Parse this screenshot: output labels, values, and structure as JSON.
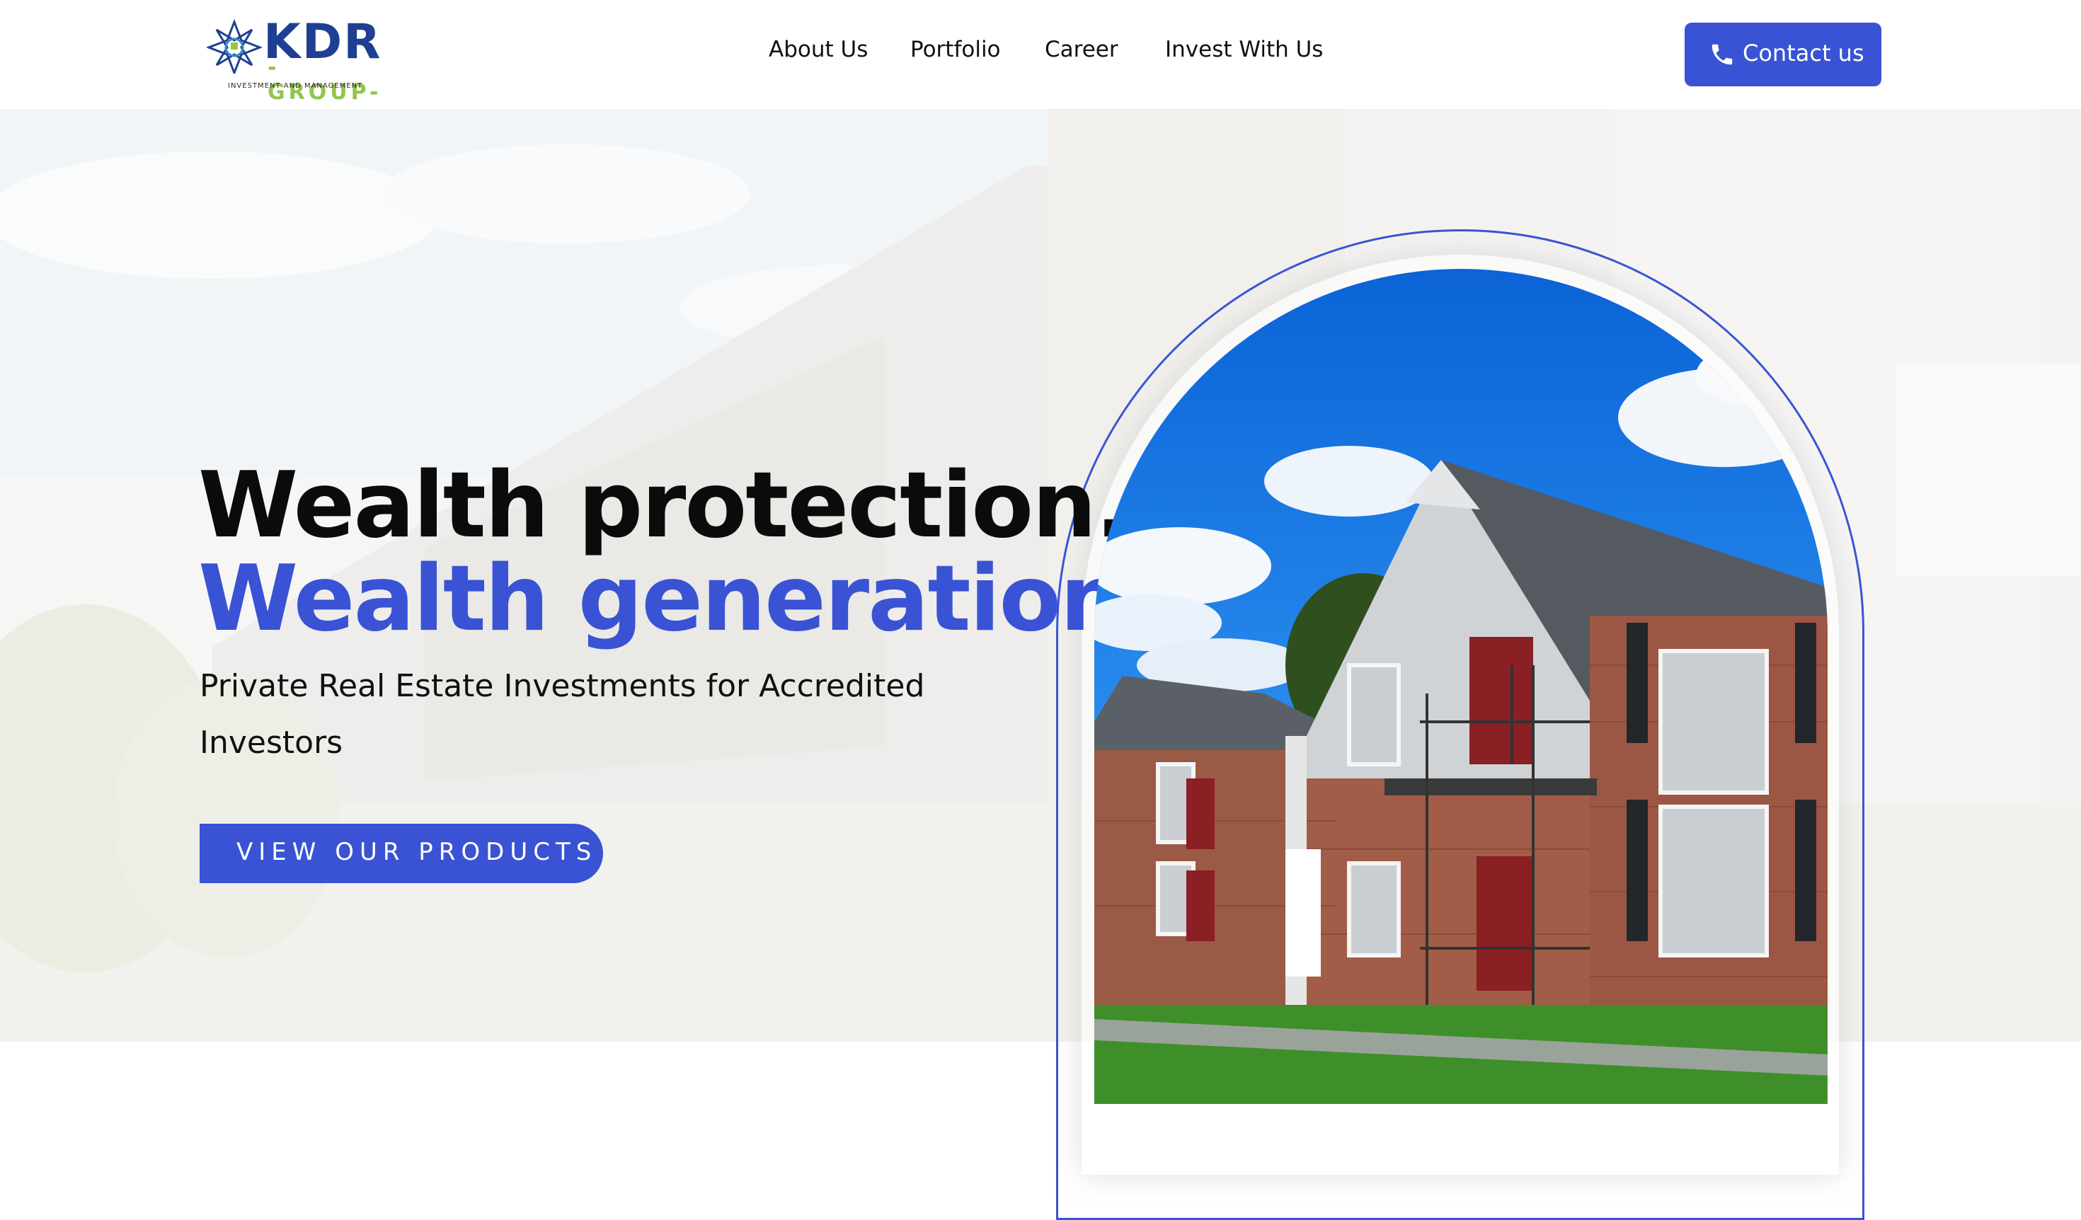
{
  "brand": {
    "name": "KDR",
    "sub": "-GROUP-",
    "tagline": "INVESTMENT AND MANAGEMENT",
    "primary_color": "#3953d4",
    "logo_dark": "#1f3f94",
    "logo_green": "#93c54b"
  },
  "nav": {
    "items": [
      {
        "label": "About Us"
      },
      {
        "label": "Portfolio"
      },
      {
        "label": "Career"
      },
      {
        "label": "Invest With Us"
      }
    ],
    "contact": {
      "label": "Contact us",
      "icon": "phone-icon"
    }
  },
  "hero": {
    "headline_1": "Wealth protection.",
    "headline_2": "Wealth generation.",
    "subtitle": "Private Real Estate Investments for Accredited Investors",
    "cta": "VIEW OUR PRODUCTS",
    "image": "apartment-building-photo"
  }
}
